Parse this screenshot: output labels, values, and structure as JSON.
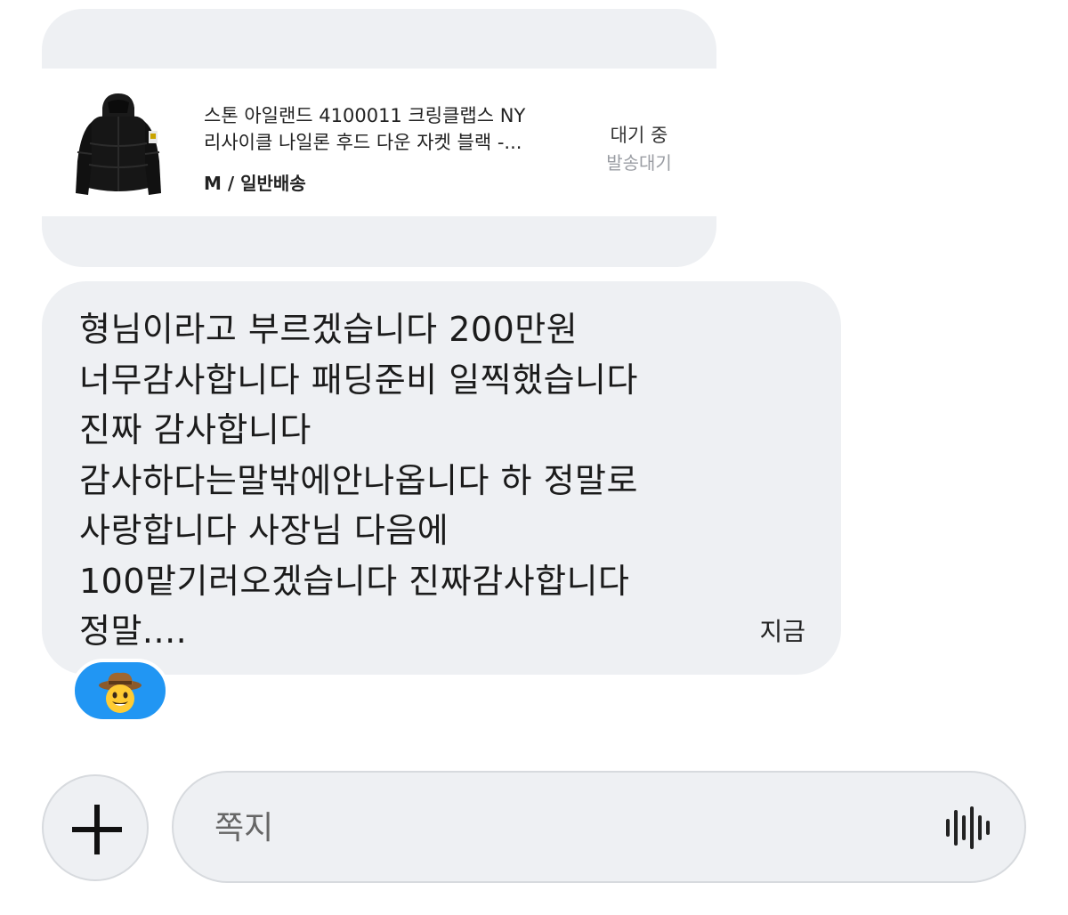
{
  "product_message": {
    "name_line1": "스톤 아일랜드 4100011 크링클랩스 NY",
    "name_line2": "리사이클 나일론 후드 다운 자켓 블랙 -...",
    "option": "M / 일반배송",
    "status": "대기 중",
    "substatus": "발송대기",
    "thumbnail_icon": "black-down-jacket-image"
  },
  "text_message": {
    "text": "형님이라고 부르겠습니다 200만원\n너무감사합니다 패딩준비 일찍했습니다\n진짜 감사합니다\n감사하다는말밖에안나옵니다 하 정말로\n사랑합니다 사장님 다음에\n100맡기러오겠습니다 진짜감사합니다\n정말....",
    "time": "지금"
  },
  "reaction": {
    "icon": "cowboy-face-emoji",
    "color": "#2196f3"
  },
  "composer": {
    "add_icon": "plus-icon",
    "placeholder": "쪽지",
    "voice_icon": "voice-waveform-icon"
  }
}
